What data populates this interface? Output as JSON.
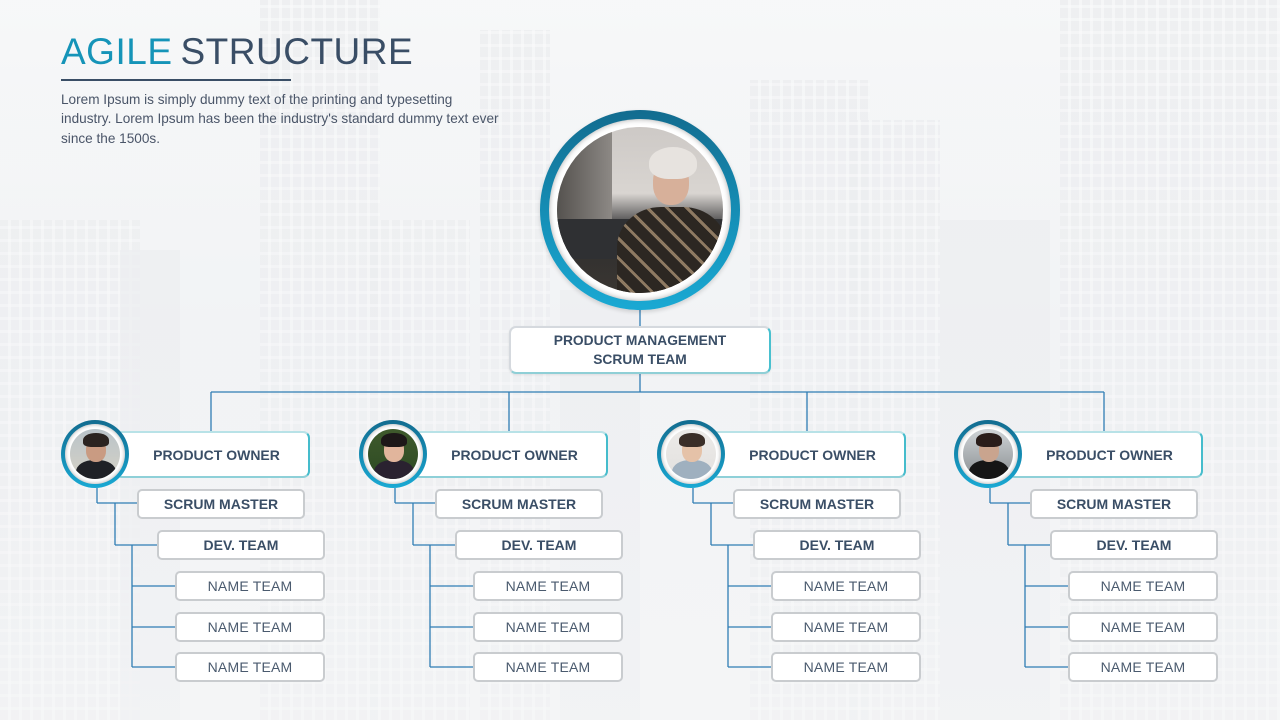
{
  "header": {
    "title_accent": "AGILE",
    "title_main": "STRUCTURE",
    "description": "Lorem Ipsum is simply dummy text of the printing and typesetting industry. Lorem Ipsum has been the industry's standard dummy text ever since the 1500s."
  },
  "colors": {
    "accent": "#1594b8",
    "title_dark": "#3a4e66",
    "connector": "#2f7db4",
    "ring_dark": "#136c8f",
    "ring_light": "#1aa9d3"
  },
  "root": {
    "photo": "woman-short-platinum-hair-portrait",
    "label_line1": "PRODUCT MANAGEMENT",
    "label_line2": "SCRUM TEAM"
  },
  "teams": [
    {
      "photo": "man-beard-portrait",
      "owner_label": "PRODUCT OWNER",
      "scrum_master_label": "SCRUM MASTER",
      "dev_team_label": "DEV. TEAM",
      "members": [
        "NAME TEAM",
        "NAME TEAM",
        "NAME TEAM"
      ]
    },
    {
      "photo": "woman-black-hat-smiling-portrait",
      "owner_label": "PRODUCT OWNER",
      "scrum_master_label": "SCRUM MASTER",
      "dev_team_label": "DEV. TEAM",
      "members": [
        "NAME TEAM",
        "NAME TEAM",
        "NAME TEAM"
      ]
    },
    {
      "photo": "woman-hat-denim-shirt-portrait",
      "owner_label": "PRODUCT OWNER",
      "scrum_master_label": "SCRUM MASTER",
      "dev_team_label": "DEV. TEAM",
      "members": [
        "NAME TEAM",
        "NAME TEAM",
        "NAME TEAM"
      ]
    },
    {
      "photo": "woman-dark-coat-snowy-trees-portrait",
      "owner_label": "PRODUCT OWNER",
      "scrum_master_label": "SCRUM MASTER",
      "dev_team_label": "DEV. TEAM",
      "members": [
        "NAME TEAM",
        "NAME TEAM",
        "NAME TEAM"
      ]
    }
  ]
}
